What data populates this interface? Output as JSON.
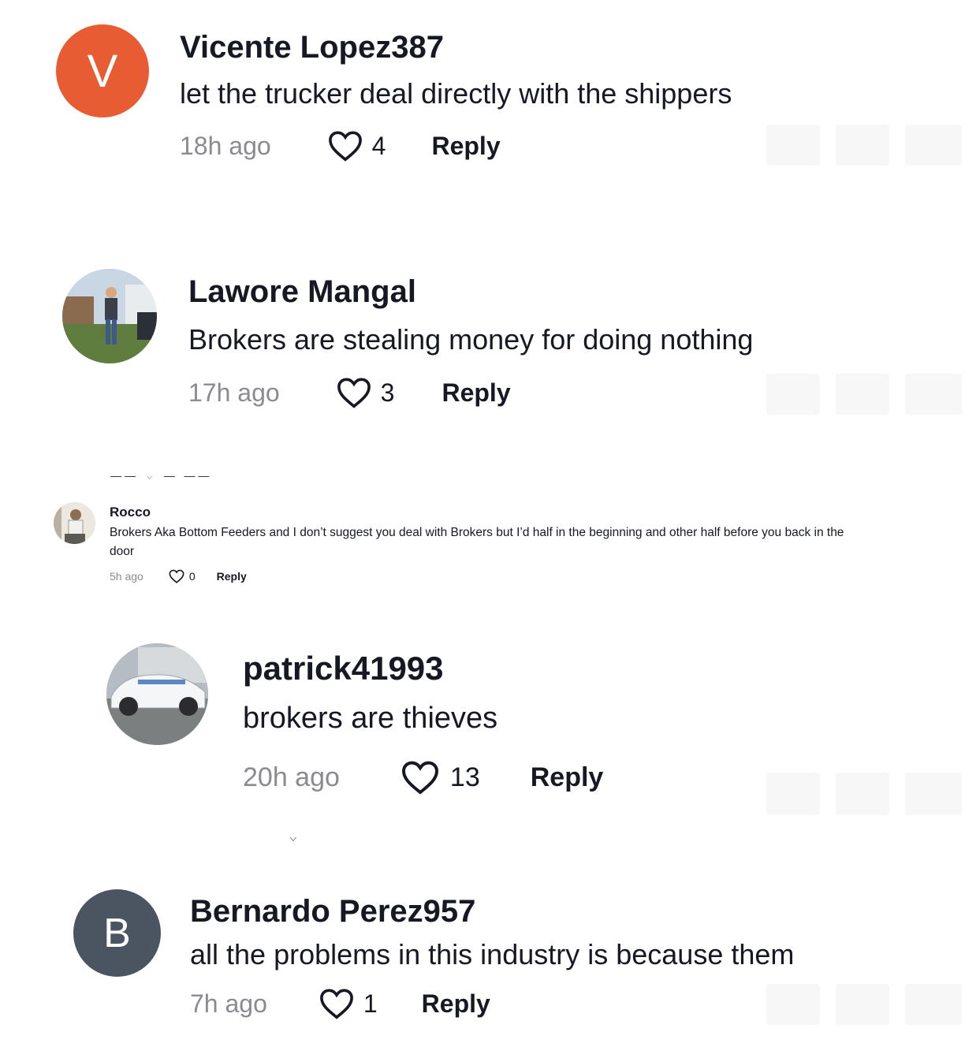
{
  "comments": [
    {
      "id": "c1",
      "author": "Vicente Lopez387",
      "text": "let the trucker deal directly with the shippers",
      "time": "18h ago",
      "likes": "4",
      "reply": "Reply",
      "avatar_letter": "V",
      "avatar_color": "#e85c33"
    },
    {
      "id": "c2",
      "author": "Lawore Mangal",
      "text": "Brokers are stealing money for doing nothing",
      "time": "17h ago",
      "likes": "3",
      "reply": "Reply",
      "avatar_desc": "photo"
    },
    {
      "id": "c3",
      "author": "Rocco",
      "text_line1": "Brokers Aka Bottom Feeders and I don’t suggest you deal with Brokers but I’d half in the beginning and other half before you back in the",
      "text_line2": "door",
      "time": "5h ago",
      "likes": "0",
      "reply": "Reply",
      "avatar_desc": "photo"
    },
    {
      "id": "c4",
      "author": "patrick41993",
      "text": "brokers are thieves",
      "time": "20h ago",
      "likes": "13",
      "reply": "Reply",
      "avatar_desc": "photo"
    },
    {
      "id": "c5",
      "author": "Bernardo Perez957",
      "text": "all the problems in this industry is because them",
      "time": "7h ago",
      "likes": "1",
      "reply": "Reply",
      "avatar_letter": "B",
      "avatar_color": "#4a5561"
    }
  ],
  "colors": {
    "text_primary": "#161823",
    "text_muted": "#8a8b91",
    "background": "#ffffff"
  },
  "icons": {
    "like": "heart-outline-icon"
  }
}
